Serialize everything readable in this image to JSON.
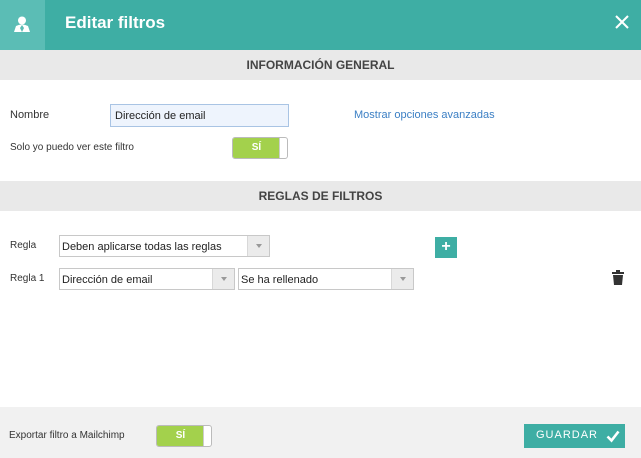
{
  "header": {
    "title": "Editar filtros",
    "user_icon": "user-icon",
    "close_icon": "close-icon",
    "accent_color": "#3eaea4"
  },
  "general": {
    "section_title": "INFORMACIÓN GENERAL",
    "name_label": "Nombre",
    "name_value": "Dirección de email",
    "advanced_link": "Mostrar opciones avanzadas",
    "private_label": "Solo yo puedo ver este filtro",
    "private_toggle": "SÍ"
  },
  "rules": {
    "section_title": "REGLAS DE FILTROS",
    "rule_label": "Regla",
    "rule_mode": "Deben aplicarse todas las reglas",
    "add_button": "+",
    "items": [
      {
        "label": "Regla 1",
        "field": "Dirección de email",
        "condition": "Se ha rellenado",
        "delete_icon": "trash-icon"
      }
    ]
  },
  "footer": {
    "export_label": "Exportar filtro a Mailchimp",
    "export_toggle": "SÍ",
    "save_label": "GUARDAR",
    "save_icon": "check-icon"
  }
}
